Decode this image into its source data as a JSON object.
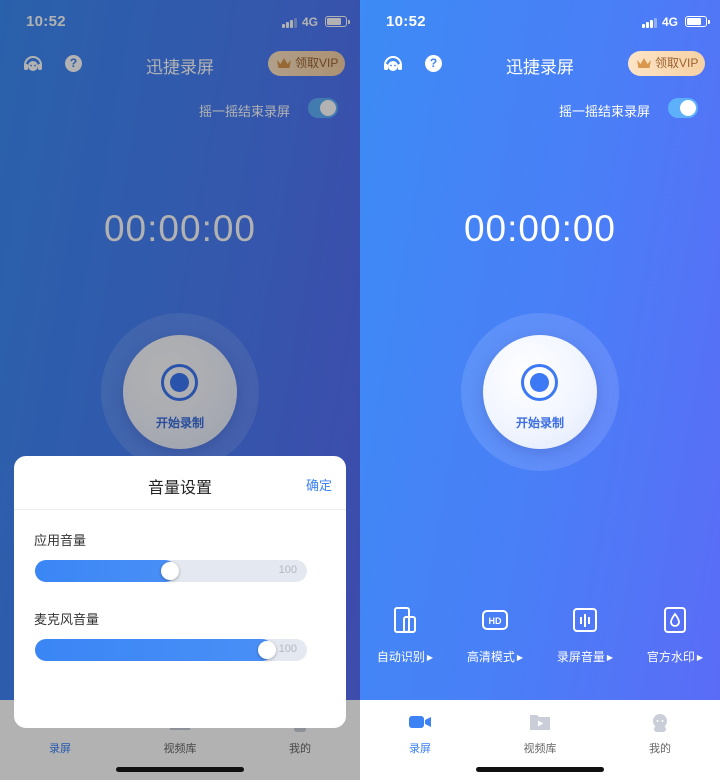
{
  "status": {
    "time": "10:52",
    "network": "4G"
  },
  "header": {
    "title": "迅捷录屏",
    "vip_label": "领取VIP",
    "help_glyph": "?"
  },
  "shake_stop": {
    "label": "摇一摇结束录屏",
    "enabled": true
  },
  "timer": "00:00:00",
  "record": {
    "label": "开始录制"
  },
  "features": [
    {
      "label": "自动识别",
      "icon": "phone-detect-icon"
    },
    {
      "label": "高清模式",
      "icon": "hd-icon"
    },
    {
      "label": "录屏音量",
      "icon": "volume-bars-icon"
    },
    {
      "label": "官方水印",
      "icon": "water-drop-icon"
    }
  ],
  "tabs": [
    {
      "label": "录屏",
      "icon": "video-camera-icon",
      "active": true
    },
    {
      "label": "视频库",
      "icon": "video-folder-icon",
      "active": false
    },
    {
      "label": "我的",
      "icon": "profile-icon",
      "active": false
    }
  ],
  "volume_sheet": {
    "title": "音量设置",
    "confirm": "确定",
    "app_volume": {
      "label": "应用音量",
      "level": 0.48,
      "max": "100"
    },
    "mic_volume": {
      "label": "麦克风音量",
      "level": 0.84,
      "max": "100"
    }
  },
  "colors": {
    "accent": "#3d82f5",
    "vip_text": "#9a6231",
    "bg_start": "#3d8bf5",
    "bg_end": "#5a6cf6"
  }
}
